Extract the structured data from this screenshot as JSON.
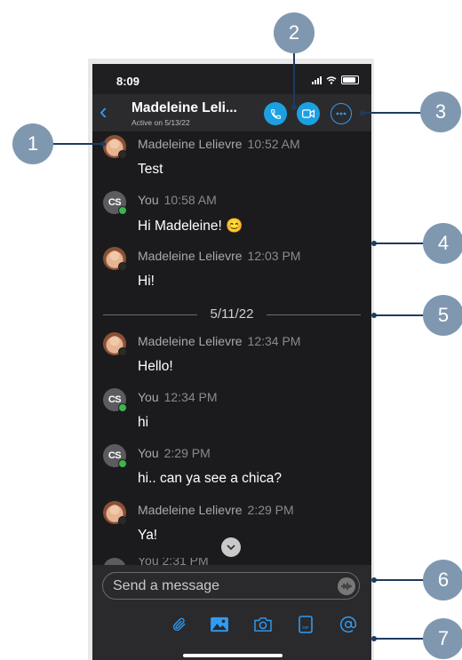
{
  "status_bar": {
    "time": "8:09"
  },
  "header": {
    "back_icon": "chevron-left-icon",
    "contact_name": "Madeleine Leli...",
    "activity": "Active on 5/13/22",
    "call_icon": "phone-icon",
    "video_icon": "video-camera-icon",
    "more_icon": "ellipsis-icon"
  },
  "messages": [
    {
      "sender": "Madeleine Lelievre",
      "time": "10:52 AM",
      "text": "Test",
      "avatar": "photo"
    },
    {
      "sender": "You",
      "time": "10:58 AM",
      "text": "Hi Madeleine! 😊",
      "avatar": "CS"
    },
    {
      "sender": "Madeleine Lelievre",
      "time": "12:03 PM",
      "text": "Hi!",
      "avatar": "photo"
    },
    {
      "sender": "Madeleine Lelievre",
      "time": "12:34 PM",
      "text": "Hello!",
      "avatar": "photo"
    },
    {
      "sender": "You",
      "time": "12:34 PM",
      "text": "hi",
      "avatar": "CS"
    },
    {
      "sender": "You",
      "time": "2:29 PM",
      "text": "hi.. can ya see a chica?",
      "avatar": "CS"
    },
    {
      "sender": "Madeleine Lelievre",
      "time": "2:29 PM",
      "text": "Ya!",
      "avatar": "photo"
    }
  ],
  "date_divider": "5/11/22",
  "partial_message": "You 2:31 PM",
  "composer": {
    "placeholder": "Send a message",
    "tools": [
      "paperclip-icon",
      "image-icon",
      "camera-icon",
      "gif-icon",
      "at-mention-icon"
    ]
  },
  "callouts": [
    "1",
    "2",
    "3",
    "4",
    "5",
    "6",
    "7"
  ],
  "colors": {
    "accent": "#2f9cf4",
    "call_button": "#1ba1e2",
    "callout_badge": "#7f98b0",
    "callout_line": "#1f3a5f"
  }
}
